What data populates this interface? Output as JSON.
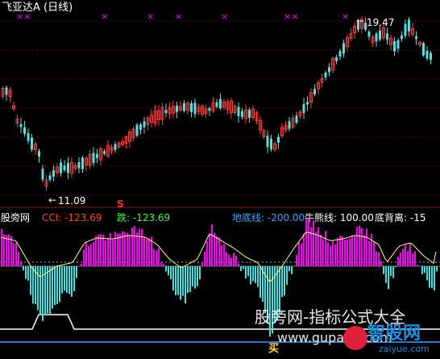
{
  "header": {
    "title": "飞亚达A (日线)",
    "title_color": "#ffffff"
  },
  "price_chart": {
    "high_label": "19.47",
    "low_label": "11.09",
    "marker_s": "S",
    "x_marks": [
      "××",
      "×",
      "×",
      "×",
      "×",
      "××",
      "×"
    ],
    "up_color": "#ff3b3b",
    "down_color": "#54e0e0",
    "grid_color": "#5a1212",
    "mark_color": "#ff00ff"
  },
  "indicator_bar": {
    "source": "股旁网",
    "cci_label": "CCI: -123.69",
    "die_label": "跌: -123.69",
    "di_label": "地底线: -200.00",
    "niu_label": "牛熊线: 100.00",
    "bei_label": "底背离: -15",
    "label_color": "#ff4040",
    "green_color": "#40ff40",
    "blue_color": "#40a0ff",
    "white_color": "#ffffff"
  },
  "indicator_chart": {
    "pos_color": "#ff00ff",
    "neg_color": "#40e0e0",
    "line_color": "#ffff80",
    "buy_marker": "买"
  },
  "watermark": {
    "line1": "股旁网-指标公式大全",
    "line2": "www.gupang.com",
    "logo_text": "智股网",
    "logo_sub": "zaiyue.com"
  }
}
